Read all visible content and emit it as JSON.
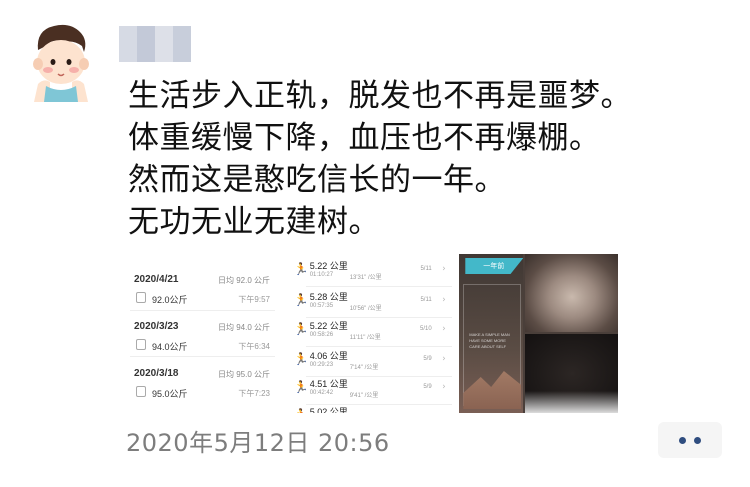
{
  "post": {
    "lines": [
      "生活步入正轨，脱发也不再是噩梦。",
      "体重缓慢下降，血压也不再爆棚。",
      "然而这是憨吃信长的一年。",
      "无功无业无建树。"
    ],
    "timestamp": "2020年5月12日 20:56"
  },
  "images": {
    "weight_log": {
      "entries": [
        {
          "date": "2020/4/21",
          "avg": "日均 92.0 公斤",
          "value": "92.0公斤",
          "time": "下午9:57"
        },
        {
          "date": "2020/3/23",
          "avg": "日均 94.0 公斤",
          "value": "94.0公斤",
          "time": "下午6:34"
        },
        {
          "date": "2020/3/18",
          "avg": "日均 95.0 公斤",
          "value": "95.0公斤",
          "time": "下午7:23"
        }
      ]
    },
    "running_log": {
      "entries": [
        {
          "distance": "5.22 公里",
          "duration": "01:10:27",
          "pace": "13'31\" /公里",
          "date": "5/11"
        },
        {
          "distance": "5.28 公里",
          "duration": "00:57:35",
          "pace": "10'56\" /公里",
          "date": "5/11"
        },
        {
          "distance": "5.22 公里",
          "duration": "00:58:26",
          "pace": "11'11\" /公里",
          "date": "5/10"
        },
        {
          "distance": "4.06 公里",
          "duration": "00:29:23",
          "pace": "7'14\" /公里",
          "date": "5/9"
        },
        {
          "distance": "4.51 公里",
          "duration": "00:42:42",
          "pace": "9'41\" /公里",
          "date": "5/9"
        },
        {
          "distance": "5.02 公里",
          "duration": "",
          "pace": "",
          "date": ""
        }
      ]
    },
    "hair_photo": {
      "tag": "一年前",
      "caption": "MAKE A SIMPLE MAN HAVE SOME MORE CARE ABOUT SELF"
    }
  },
  "colors": {
    "timestamp": "#7d7d7d",
    "more_dots": "#2f4d7f",
    "hair_tag": "#43b8c9"
  },
  "icons": {
    "more": "more-dots-icon",
    "runner": "running-icon",
    "weight": "scale-icon"
  }
}
